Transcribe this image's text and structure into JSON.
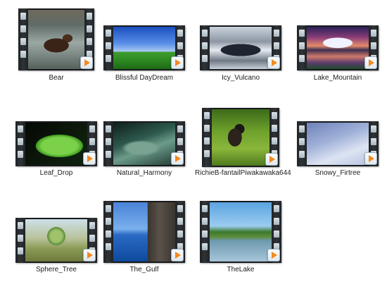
{
  "videos": [
    {
      "name": "Bear",
      "thumbnail": "bear-in-river"
    },
    {
      "name": "Blissful DayDream",
      "thumbnail": "green-hill-blue-sky"
    },
    {
      "name": "Icy_Vulcano",
      "thumbnail": "icy-volcano-crater"
    },
    {
      "name": "Lake_Mountain",
      "thumbnail": "mountain-lake-sunset"
    },
    {
      "name": "Leaf_Drop",
      "thumbnail": "leaf-water-drops"
    },
    {
      "name": "Natural_Harmony",
      "thumbnail": "green-water-scene"
    },
    {
      "name": "RichieB-fantailPiwakawaka644",
      "thumbnail": "fantail-bird"
    },
    {
      "name": "Snowy_Firtree",
      "thumbnail": "snowy-fir-branch"
    },
    {
      "name": "Sphere_Tree",
      "thumbnail": "sphere-tree"
    },
    {
      "name": "The_Gulf",
      "thumbnail": "gulf-rock-formations"
    },
    {
      "name": "TheLake",
      "thumbnail": "lake-with-trees"
    }
  ],
  "colors": {
    "film_strip": "#17191c",
    "play_arrow": "#f28a1d",
    "label_text": "#1c1c1c",
    "background": "#ffffff"
  }
}
